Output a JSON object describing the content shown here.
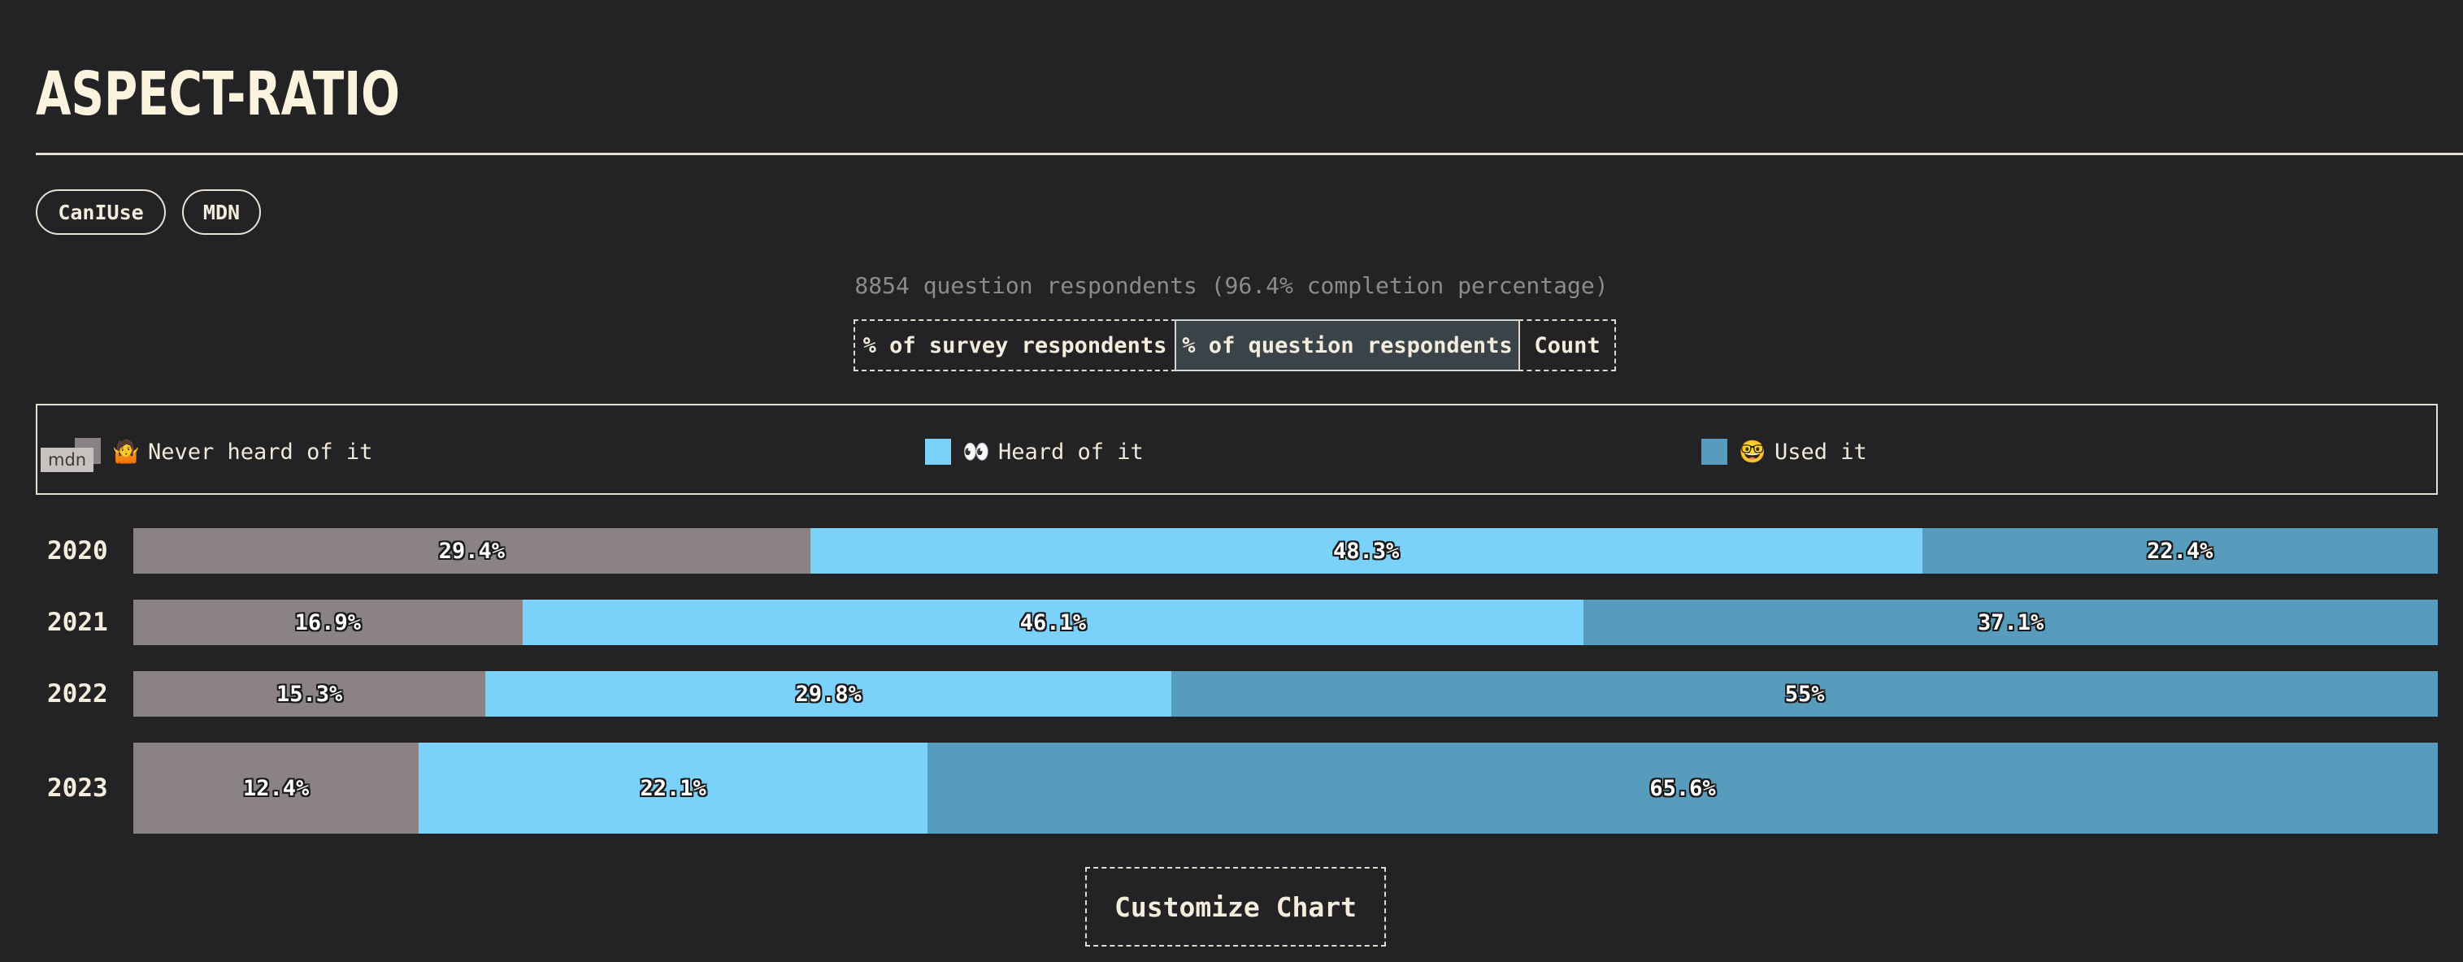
{
  "page": {
    "title": "ASPECT-RATIO"
  },
  "links": [
    {
      "label": "CanIUse"
    },
    {
      "label": "MDN"
    }
  ],
  "respondents_text": "8854 question respondents (96.4% completion percentage)",
  "unit_tabs": [
    {
      "label": "% of survey respondents",
      "selected": false
    },
    {
      "label": "% of question respondents",
      "selected": true
    },
    {
      "label": "Count",
      "selected": false
    }
  ],
  "legend": {
    "mdn_tag": "mdn",
    "items": [
      {
        "emoji": "🤷",
        "label": "Never heard of it",
        "color": "#8a8286"
      },
      {
        "emoji": "👀",
        "label": "Heard of it",
        "color": "#7ad2fb"
      },
      {
        "emoji": "🤓",
        "label": "Used it",
        "color": "#579bbd"
      }
    ]
  },
  "chart_data": {
    "type": "bar",
    "orientation": "horizontal",
    "stacked": true,
    "categories": [
      "2020",
      "2021",
      "2022",
      "2023"
    ],
    "series": [
      {
        "name": "Never heard of it",
        "color": "#8a8286",
        "values": [
          29.4,
          16.9,
          15.3,
          12.4
        ],
        "labels": [
          "29.4%",
          "16.9%",
          "15.3%",
          "12.4%"
        ]
      },
      {
        "name": "Heard of it",
        "color": "#7ad2fb",
        "values": [
          48.3,
          46.1,
          29.8,
          22.1
        ],
        "labels": [
          "48.3%",
          "46.1%",
          "29.8%",
          "22.1%"
        ]
      },
      {
        "name": "Used it",
        "color": "#579bbd",
        "values": [
          22.4,
          37.1,
          55,
          65.6
        ],
        "labels": [
          "22.4%",
          "37.1%",
          "55%",
          "65.6%"
        ]
      }
    ]
  },
  "customize_label": "Customize Chart"
}
